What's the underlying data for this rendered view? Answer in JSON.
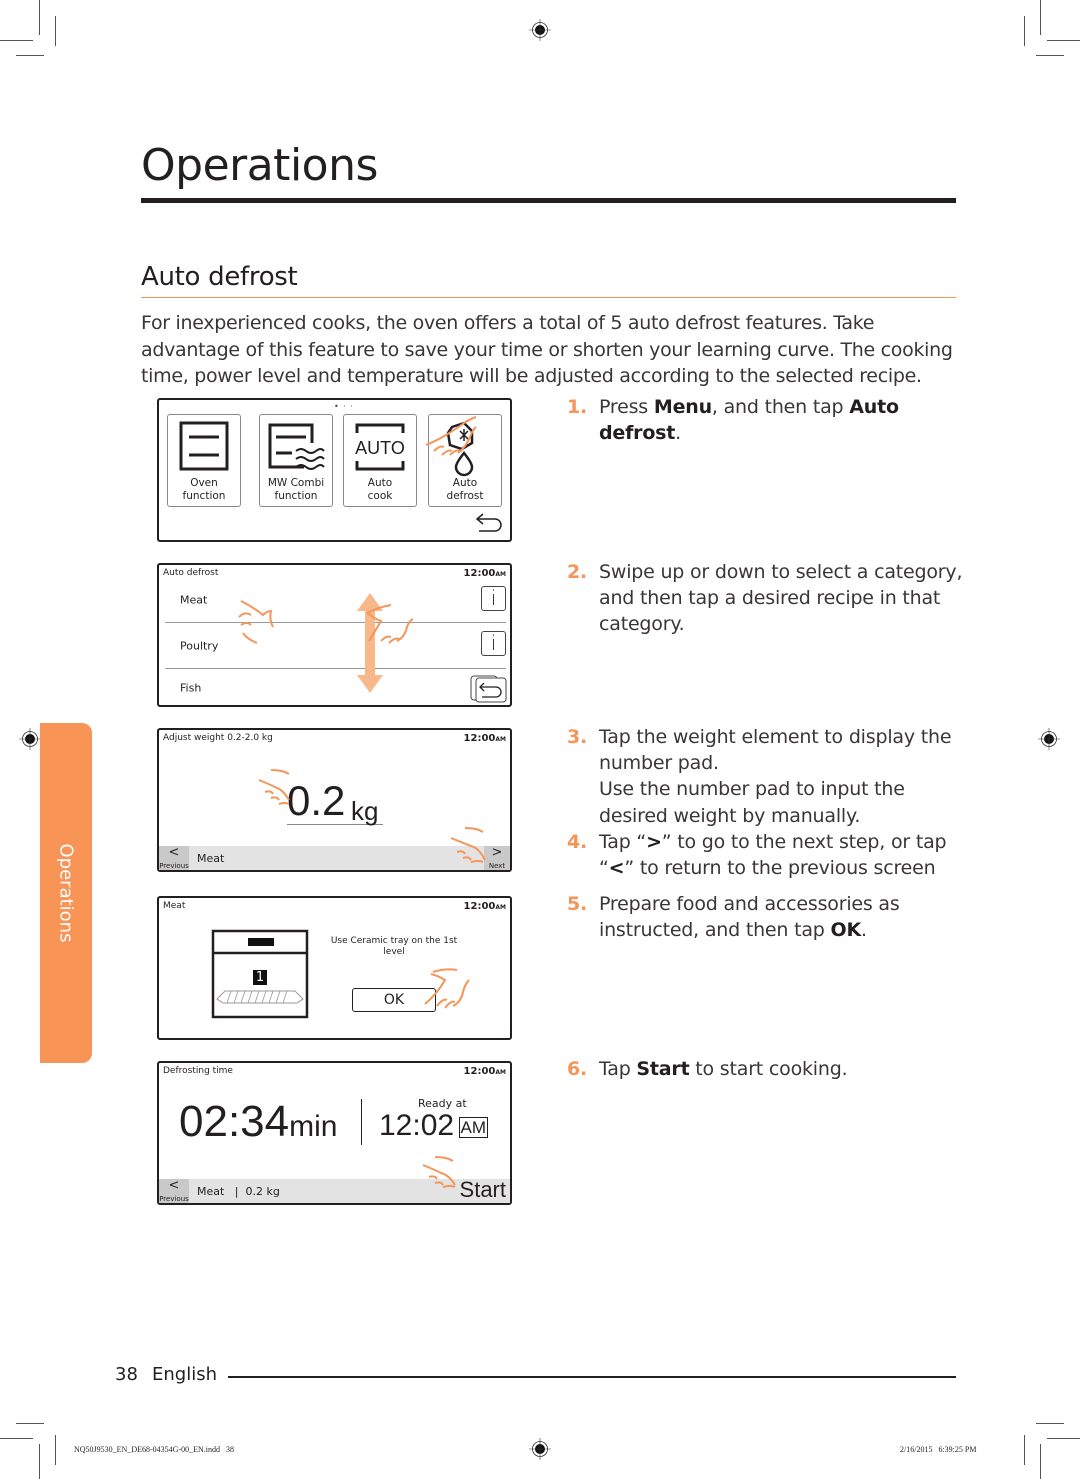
{
  "page": {
    "chapter_title": "Operations",
    "section_title": "Auto defrost",
    "intro": "For inexperienced cooks, the oven offers a total of 5 auto defrost features. Take advantage of this feature to save your time or shorten your learning curve. The cooking time, power level and temperature will be adjusted according to the selected recipe.",
    "side_tab": "Operations",
    "accent_color": "#f4955a"
  },
  "steps": [
    {
      "num": "1.",
      "parts": [
        "Press ",
        {
          "b": "Menu"
        },
        ", and then tap ",
        {
          "b": "Auto defrost"
        },
        "."
      ]
    },
    {
      "num": "2.",
      "parts": [
        "Swipe up or down to select a category, and then tap a desired recipe in that category."
      ]
    },
    {
      "num": "3.",
      "parts": [
        "Tap the weight element to display the number pad.\nUse the number pad to input the desired weight by manually."
      ]
    },
    {
      "num": "4.",
      "parts": [
        "Tap “",
        {
          "b": ">"
        },
        "” to go to the next step, or tap “",
        {
          "b": "<"
        },
        "” to return to the previous screen"
      ]
    },
    {
      "num": "5.",
      "parts": [
        "Prepare food and accessories as instructed, and then tap ",
        {
          "b": "OK"
        },
        "."
      ]
    },
    {
      "num": "6.",
      "parts": [
        "Tap ",
        {
          "b": "Start"
        },
        " to start cooking."
      ]
    }
  ],
  "screen1": {
    "page_dots": "• · ·",
    "tiles": [
      {
        "label1": "Oven",
        "label2": "function",
        "icon": "oven-icon"
      },
      {
        "label1": "MW Combi",
        "label2": "function",
        "icon": "mw-combi-icon"
      },
      {
        "label1": "Auto",
        "label2": "cook",
        "icon": "auto-cook-icon",
        "icon_text": "AUTO"
      },
      {
        "label1": "Auto",
        "label2": "defrost",
        "icon": "auto-defrost-icon"
      }
    ],
    "back_icon": "back-icon"
  },
  "screen2": {
    "title": "Auto defrost",
    "time": "12:00",
    "ampm": "AM",
    "items": [
      "Meat",
      "Poultry",
      "Fish"
    ],
    "info_glyph": "i"
  },
  "screen3": {
    "title": "Adjust weight 0.2-2.0 kg",
    "time": "12:00",
    "ampm": "AM",
    "weight_value": "0.2",
    "weight_unit": "kg",
    "prev_glyph": "<",
    "prev_label": "Previous",
    "next_glyph": ">",
    "next_label": "Next",
    "bar_text": "Meat"
  },
  "screen4": {
    "title": "Meat",
    "time": "12:00",
    "ampm": "AM",
    "instruction": "Use Ceramic tray on the 1st level",
    "level": "1",
    "ok_label": "OK"
  },
  "screen5": {
    "title": "Defrosting time",
    "time": "12:00",
    "ampm": "AM",
    "duration": "02:34",
    "duration_unit": "min",
    "ready_label": "Ready at",
    "ready_time": "12:02",
    "ready_ampm": "AM",
    "prev_glyph": "<",
    "prev_label": "Previous",
    "bar_text": "Meat   |  0.2 kg",
    "start_label": "Start"
  },
  "footer": {
    "page_number": "38",
    "language": "English",
    "slug_file": "NQ50J9530_EN_DE68-04354G-00_EN.indd   38",
    "slug_date": "2/16/2015   6:39:25 PM"
  }
}
